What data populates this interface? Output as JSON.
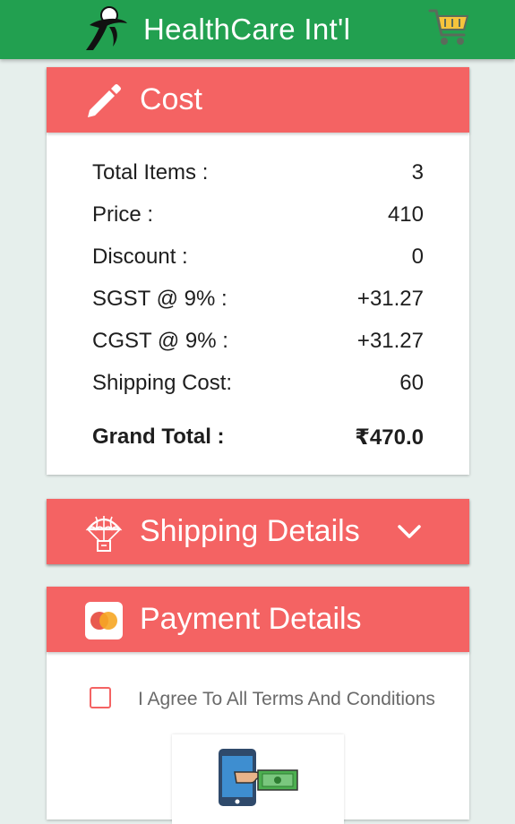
{
  "app": {
    "title": "HealthCare Int'l"
  },
  "cost": {
    "header": "Cost",
    "rows": [
      {
        "label": "Total Items :",
        "value": "3"
      },
      {
        "label": "Price :",
        "value": "410"
      },
      {
        "label": "Discount :",
        "value": "0"
      },
      {
        "label": "SGST @ 9% :",
        "value": "+31.27"
      },
      {
        "label": "CGST @ 9% :",
        "value": "+31.27"
      },
      {
        "label": "Shipping Cost:",
        "value": "60"
      }
    ],
    "grand_total": {
      "label": "Grand Total :",
      "value": "₹470.0"
    }
  },
  "shipping": {
    "header": "Shipping Details"
  },
  "payment": {
    "header": "Payment Details",
    "agree_text": "I Agree To All Terms And Conditions"
  },
  "colors": {
    "topbar": "#22a050",
    "card_header": "#f46363",
    "background": "#e6efec"
  },
  "icons": [
    "logo-icon",
    "cart-icon",
    "pencil-icon",
    "parachute-icon",
    "chevron-down-icon",
    "card-icon",
    "phone-payment-icon"
  ]
}
